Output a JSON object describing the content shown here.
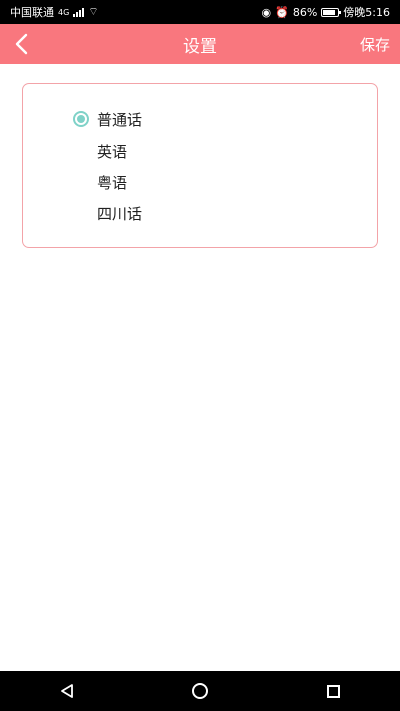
{
  "status": {
    "carrier": "中国联通",
    "signal_label": "4G",
    "battery_percent": "86%",
    "time": "傍晚5:16"
  },
  "appbar": {
    "title": "设置",
    "save_label": "保存"
  },
  "options": [
    {
      "label": "普通话",
      "selected": true
    },
    {
      "label": "英语",
      "selected": false
    },
    {
      "label": "粤语",
      "selected": false
    },
    {
      "label": "四川话",
      "selected": false
    }
  ],
  "colors": {
    "accent": "#f9777e",
    "radio": "#7fd2c8",
    "card_border": "#f3a3a8"
  }
}
